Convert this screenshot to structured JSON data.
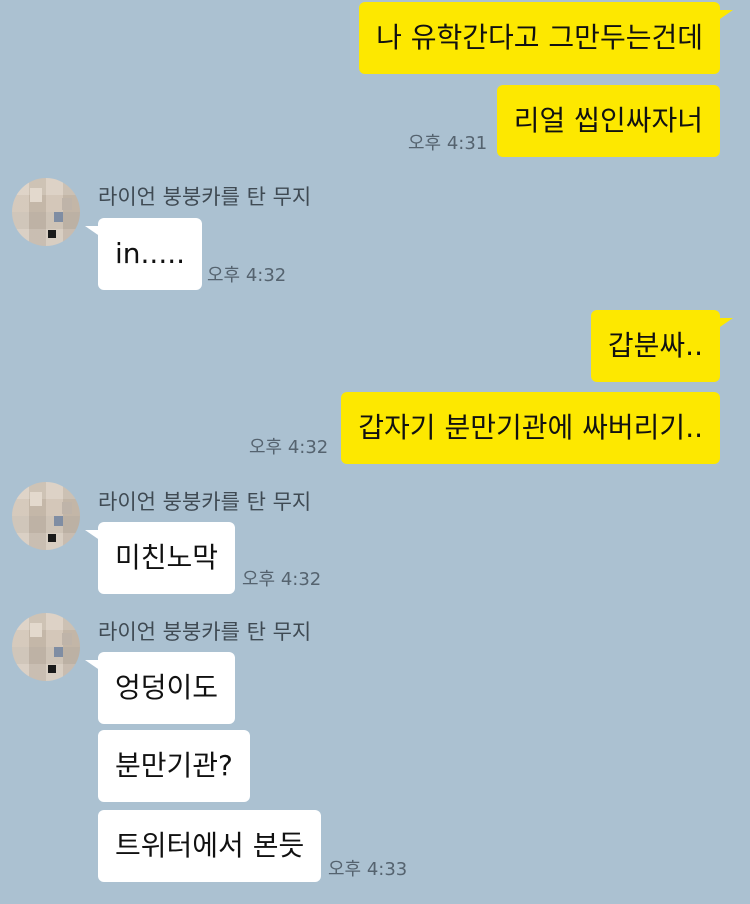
{
  "chat": {
    "messages": [
      {
        "sender": "me",
        "text": "나 유학간다고 그만두는건데"
      },
      {
        "sender": "me",
        "text": "리얼 씹인싸자너",
        "time": "오후 4:31"
      },
      {
        "sender": "라이언 붕붕카를 탄 무지",
        "text": "in.....",
        "time": "오후 4:32"
      },
      {
        "sender": "me",
        "text": "갑분싸.."
      },
      {
        "sender": "me",
        "text": "갑자기 분만기관에 싸버리기..",
        "time": "오후 4:32"
      },
      {
        "sender": "라이언 붕붕카를 탄 무지",
        "text": "미친노막",
        "time": "오후 4:32"
      },
      {
        "sender": "라이언 붕붕카를 탄 무지",
        "text": "엉덩이도"
      },
      {
        "sender": "라이언 붕붕카를 탄 무지",
        "text": "분만기관?"
      },
      {
        "sender": "라이언 붕붕카를 탄 무지",
        "text": "트위터에서 본듯",
        "time": "오후 4:33"
      }
    ]
  },
  "colors": {
    "background": "#abc1d1",
    "my_bubble": "#fde800",
    "their_bubble": "#ffffff"
  },
  "icons": {
    "avatar": "avatar-icon"
  }
}
